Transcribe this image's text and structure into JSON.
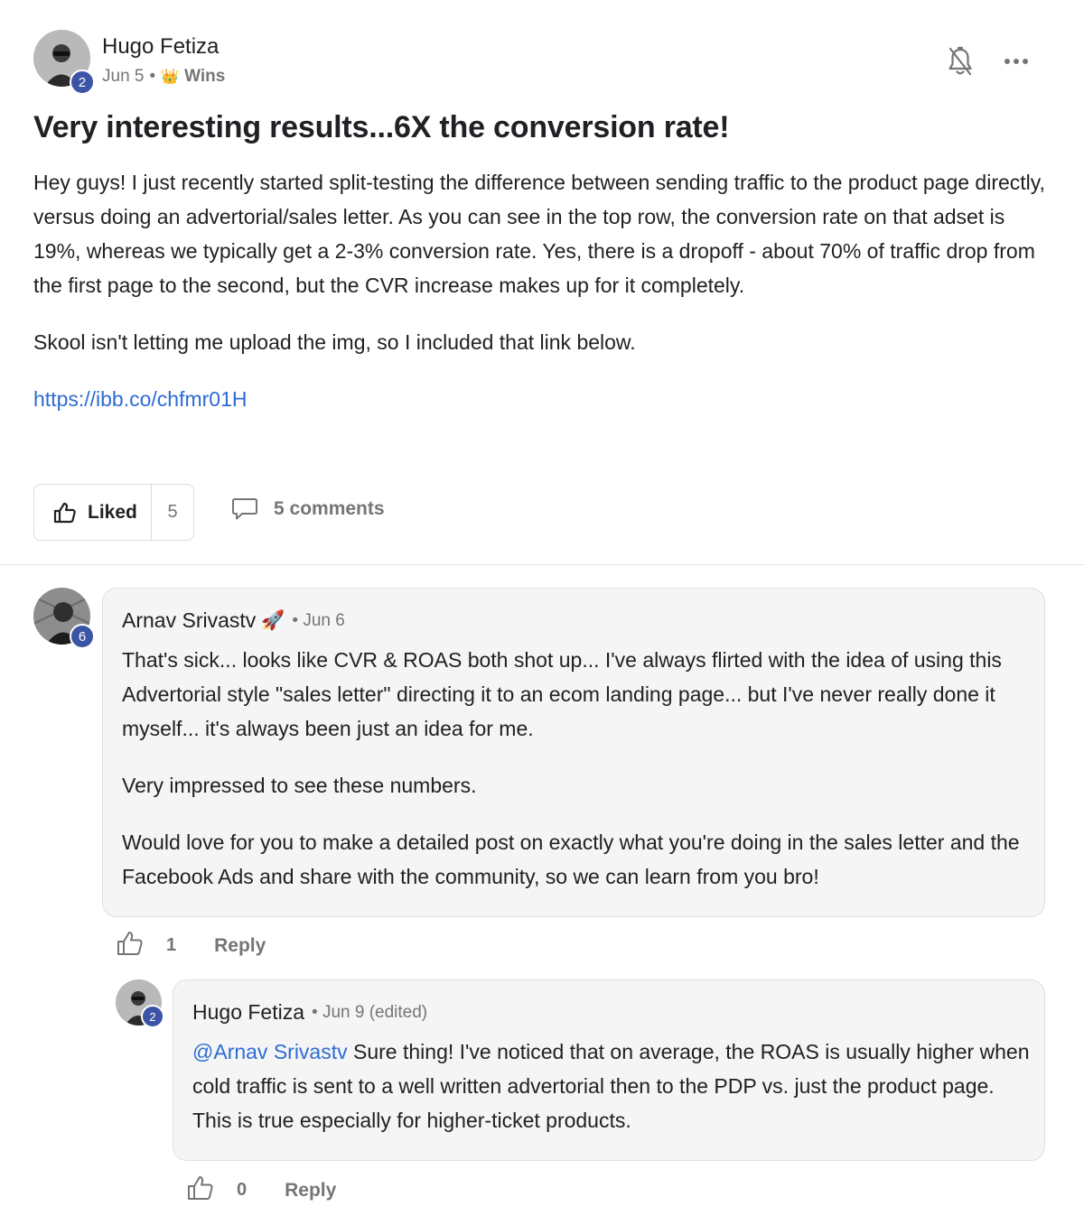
{
  "post": {
    "author": {
      "name": "Hugo Fetiza",
      "level": "2"
    },
    "date": "Jun 5",
    "separator": "•",
    "category_icon": "👑",
    "category": "Wins",
    "title": "Very interesting results...6X the conversion rate!",
    "body_paragraphs": [
      "Hey guys! I just recently started split-testing the difference between sending traffic to the product page directly, versus doing an advertorial/sales letter. As you can see in the top row, the conversion rate on that adset is 19%, whereas we typically get a 2-3% conversion rate. Yes, there is a dropoff - about 70% of traffic drop from the first page to the second, but the CVR increase makes up for it completely.",
      "Skool isn't letting me upload the img, so I included that link below."
    ],
    "link": "https://ibb.co/chfmr01H",
    "like_label": "Liked",
    "like_count": "5",
    "comments_label": "5 comments",
    "icons": [
      "bell-off-icon",
      "more-icon",
      "thumbs-up-icon",
      "comment-icon"
    ]
  },
  "comments": [
    {
      "author": {
        "name": "Arnav Srivastv",
        "level": "6"
      },
      "badge_emoji": "🚀",
      "meta": "• Jun 6",
      "paragraphs": [
        "That's sick... looks like CVR & ROAS both shot up... I've always flirted with the idea of using this Advertorial style \"sales letter\" directing it to an ecom landing page... but I've never really done it myself... it's always been just an idea for me.",
        "Very impressed to see these numbers.",
        "Would love for you to make a detailed post on exactly what you're doing in the sales letter and the Facebook Ads and share with the community, so we can learn from you bro!"
      ],
      "like_count": "1",
      "reply_label": "Reply"
    },
    {
      "author": {
        "name": "Hugo Fetiza",
        "level": "2"
      },
      "meta": "• Jun 9 (edited)",
      "mention": "@Arnav Srivastv",
      "text": " Sure thing! I've noticed that on average, the ROAS is usually higher when cold traffic is sent to a well written advertorial then to the PDP vs. just the product page. This is true especially for higher-ticket products.",
      "like_count": "0",
      "reply_label": "Reply"
    }
  ],
  "colors": {
    "link": "#2e6bd3",
    "level_badge": "#3c54a5",
    "muted_text": "#757575",
    "bubble_bg": "#f5f5f5"
  }
}
